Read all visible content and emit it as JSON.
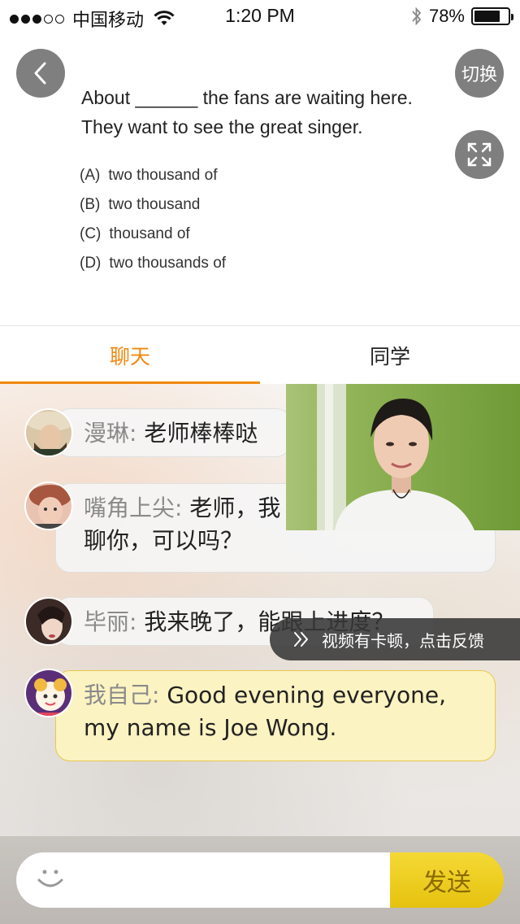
{
  "status_bar": {
    "carrier": "中国移动",
    "time": "1:20 PM",
    "battery": "78%",
    "battery_level": 0.78
  },
  "toolbar": {
    "switch_label": "切换"
  },
  "question": {
    "line1": "About ______ the fans are waiting here.",
    "line2": "They want to see the great singer.",
    "options": [
      {
        "letter": "(A)",
        "text": "two thousand of"
      },
      {
        "letter": "(B)",
        "text": "two thousand"
      },
      {
        "letter": "(C)",
        "text": "thousand of"
      },
      {
        "letter": "(D)",
        "text": "two thousands of"
      }
    ]
  },
  "tabs": [
    {
      "label": "聊天",
      "active": true
    },
    {
      "label": "同学",
      "active": false
    }
  ],
  "messages": [
    {
      "name": "漫琳:",
      "text": " 老师棒棒哒"
    },
    {
      "name": "嘴角上尖:",
      "text": " 老师，我",
      "text2": "聊你，可以吗？"
    },
    {
      "name": "毕丽:",
      "text": " 我来晚了，能跟上进度？"
    },
    {
      "name": "我自己:",
      "text": " Good evening everyone,",
      "text2": "my name is Joe Wong."
    }
  ],
  "feedback": {
    "label": "视频有卡顿，点击反馈"
  },
  "input": {
    "send_label": "发送"
  },
  "colors": {
    "accent": "#f0890f",
    "send": "#f0d022"
  }
}
